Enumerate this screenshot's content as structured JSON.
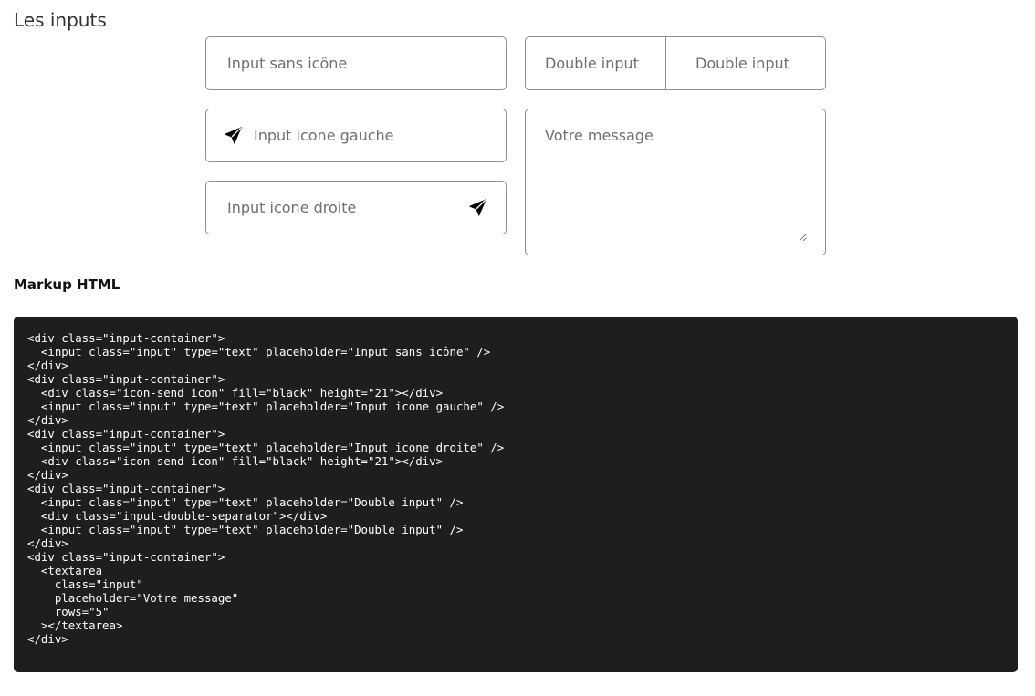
{
  "section": {
    "title": "Les inputs"
  },
  "inputs": {
    "plain": {
      "placeholder": "Input sans icône"
    },
    "icon_left": {
      "placeholder": "Input icone gauche",
      "icon": "send-icon"
    },
    "icon_right": {
      "placeholder": "Input icone droite",
      "icon": "send-icon"
    },
    "double": {
      "first_placeholder": "Double input",
      "second_placeholder": "Double input"
    },
    "textarea": {
      "placeholder": "Votre message"
    }
  },
  "markup": {
    "title": "Markup HTML",
    "code": "<div class=\"input-container\">\n  <input class=\"input\" type=\"text\" placeholder=\"Input sans icône\" />\n</div>\n<div class=\"input-container\">\n  <div class=\"icon-send icon\" fill=\"black\" height=\"21\"></div>\n  <input class=\"input\" type=\"text\" placeholder=\"Input icone gauche\" />\n</div>\n<div class=\"input-container\">\n  <input class=\"input\" type=\"text\" placeholder=\"Input icone droite\" />\n  <div class=\"icon-send icon\" fill=\"black\" height=\"21\"></div>\n</div>\n<div class=\"input-container\">\n  <input class=\"input\" type=\"text\" placeholder=\"Double input\" />\n  <div class=\"input-double-separator\"></div>\n  <input class=\"input\" type=\"text\" placeholder=\"Double input\" />\n</div>\n<div class=\"input-container\">\n  <textarea\n    class=\"input\"\n    placeholder=\"Votre message\"\n    rows=\"5\"\n  ></textarea>\n</div>"
  },
  "colors": {
    "border": "#8f8f8f",
    "code_bg": "#1e1e1e",
    "code_text": "#ffffff",
    "placeholder": "#6f6f6f"
  }
}
